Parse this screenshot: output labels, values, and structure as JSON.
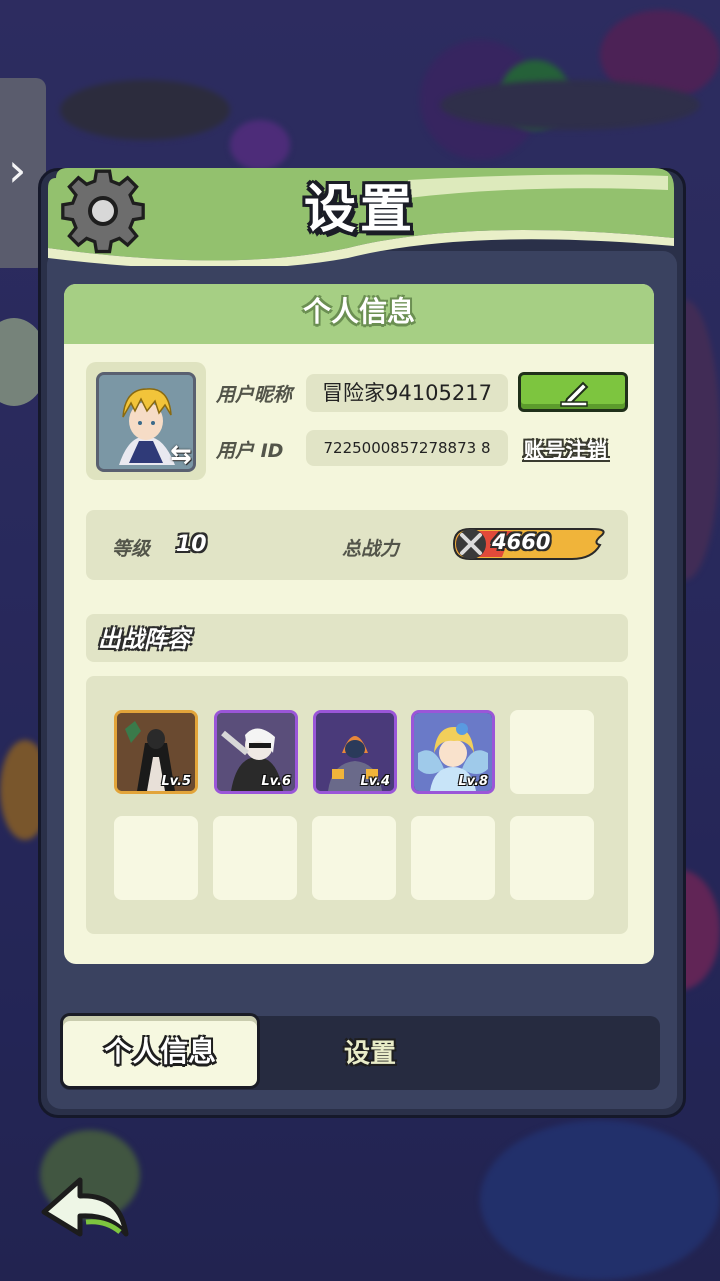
{
  "dialog": {
    "title": "设置",
    "gear_icon": "gear-icon"
  },
  "personal_info": {
    "header": "个人信息",
    "nickname_label": "用户昵称",
    "nickname_value": "冒险家94105217",
    "edit_icon": "pencil-icon",
    "id_label": "用户 ID",
    "id_value": "7225000857278873 8",
    "cancel_account_link": "账号注销",
    "level_label": "等级",
    "level_value": "10",
    "power_label": "总战力",
    "power_value": "4660"
  },
  "lineup": {
    "title": "出战阵容",
    "heroes": [
      {
        "level": "Lv.5",
        "rarity": "orange"
      },
      {
        "level": "Lv.6",
        "rarity": "purple"
      },
      {
        "level": "Lv.4",
        "rarity": "purple"
      },
      {
        "level": "Lv.8",
        "rarity": "purple"
      }
    ]
  },
  "tabs": {
    "active": "个人信息",
    "inactive": "设置"
  },
  "colors": {
    "panel_bg": "#f4f6dc",
    "header_green": "#a6cf84",
    "edit_green": "#7dc53f",
    "power_gold": "#f0b43a",
    "purple_frame": "#9a56d8",
    "orange_frame": "#e2a43a"
  }
}
